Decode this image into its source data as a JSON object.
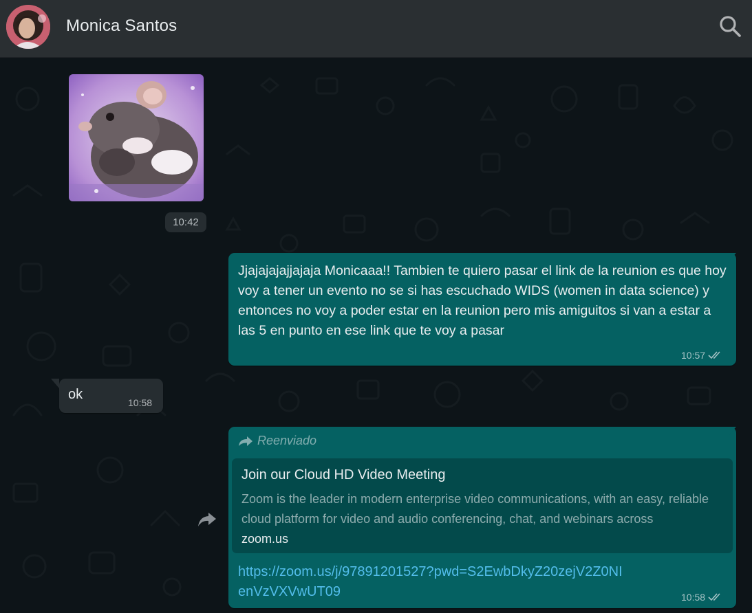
{
  "header": {
    "contact_name": "Monica Santos",
    "search_icon": "search-icon"
  },
  "messages": {
    "sticker": {
      "time": "10:42",
      "icon": "rat-sticker"
    },
    "outgoing_1": {
      "text": "Jjajajajajjajaja Monicaaa!! Tambien te quiero pasar el link de la reunion es que hoy voy a tener un evento no se si has escuchado WIDS (women in data science) y entonces no voy a poder estar en la reunion pero mis amiguitos si van a estar a las 5 en punto en ese link que te voy a pasar",
      "time": "10:57",
      "status_icon": "double-check-icon"
    },
    "incoming_1": {
      "text": "ok",
      "time": "10:58"
    },
    "outgoing_2": {
      "forwarded_label": "Reenviado",
      "preview": {
        "title": "Join our Cloud HD Video Meeting",
        "description": "Zoom is the leader in modern enterprise video communications, with an easy, reliable cloud platform for video and audio conferencing, chat, and webinars across",
        "domain": "zoom.us"
      },
      "link": "https://zoom.us/j/97891201527?pwd=S2EwbDkyZ20zejV2Z0NIenVzVXVwUT09",
      "time": "10:58",
      "status_icon": "double-check-icon"
    }
  },
  "colors": {
    "header_bg": "#2a2f32",
    "chat_bg": "#0d1418",
    "outgoing_bubble": "#056162",
    "incoming_bubble": "#262d31",
    "link": "#53bdeb"
  }
}
